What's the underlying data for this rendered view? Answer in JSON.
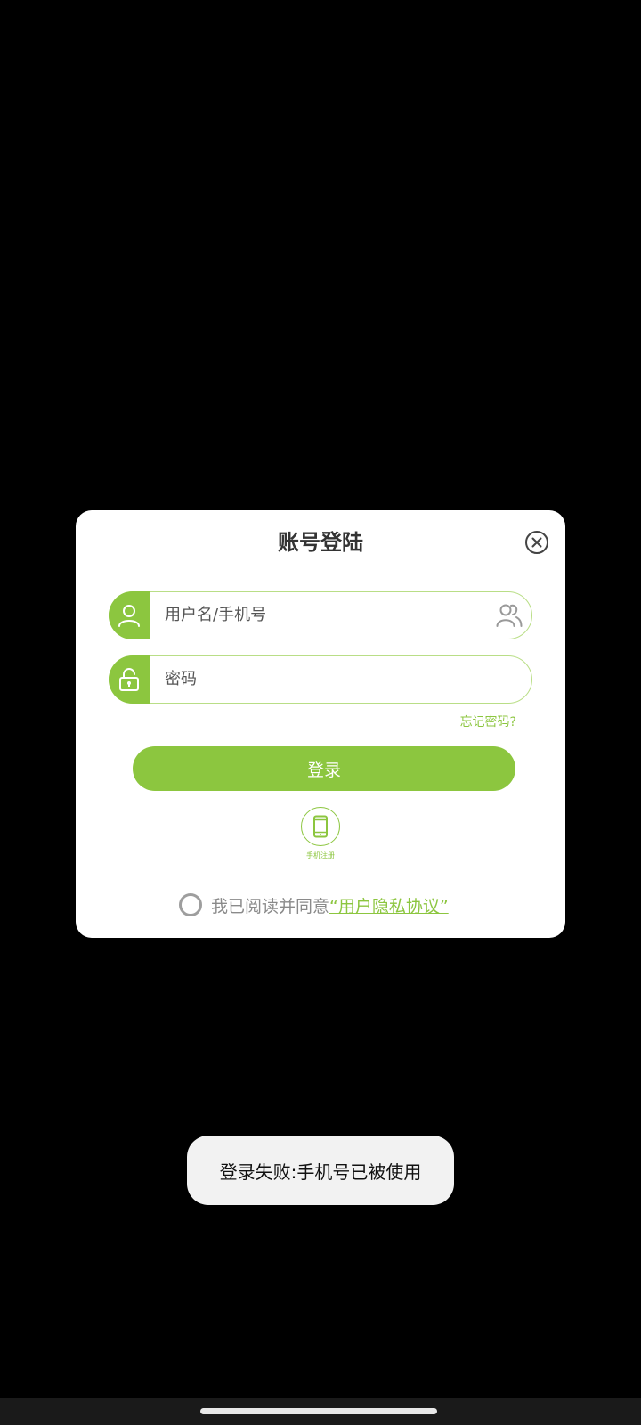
{
  "dialog": {
    "title": "账号登陆",
    "username_placeholder": "用户名/手机号",
    "password_placeholder": "密码",
    "forgot_password": "忘记密码?",
    "login_button": "登录",
    "phone_register_label": "手机注册",
    "agreement_text": "我已阅读并同意",
    "agreement_link": "“用户隐私协议”"
  },
  "toast": {
    "message": "登录失败:手机号已被使用"
  },
  "colors": {
    "accent": "#8cc63f",
    "background": "#000000",
    "dialog_bg": "#ffffff"
  },
  "icons": [
    "close-icon",
    "user-icon",
    "lock-icon",
    "contacts-icon",
    "phone-icon"
  ]
}
